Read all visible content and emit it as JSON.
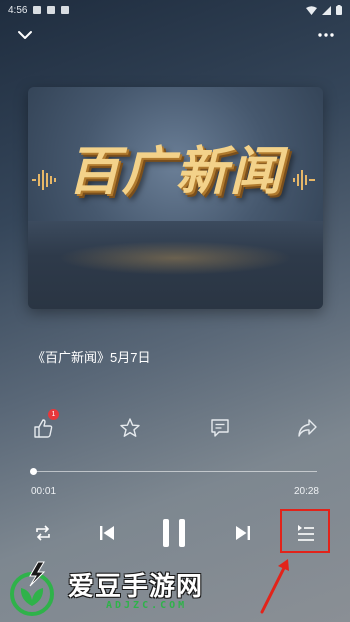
{
  "status_bar": {
    "time": "4:56",
    "icons": [
      "notification-icon",
      "notification-icon",
      "sim-icon",
      "wifi-icon",
      "signal-icon",
      "battery-icon"
    ]
  },
  "header": {
    "collapse_icon": "chevron-down-icon",
    "more_icon": "more-dots-icon"
  },
  "cover": {
    "title_text": "百广新闻"
  },
  "track": {
    "title": "《百广新闻》5月7日"
  },
  "actions": {
    "like_count": "1",
    "icons": [
      "thumbs-up-icon",
      "star-icon",
      "comment-icon",
      "share-icon"
    ]
  },
  "playback": {
    "current_time": "00:01",
    "total_time": "20:28",
    "progress_fraction": 0.001
  },
  "controls": {
    "icons": [
      "repeat-icon",
      "previous-icon",
      "pause-icon",
      "next-icon",
      "playlist-icon"
    ]
  },
  "watermark": {
    "text": "爱豆手游网",
    "domain": "ADJZC.COM"
  },
  "colors": {
    "highlight": "#e2231a",
    "badge": "#e8373b",
    "watermark_green": "#2fb24a"
  }
}
